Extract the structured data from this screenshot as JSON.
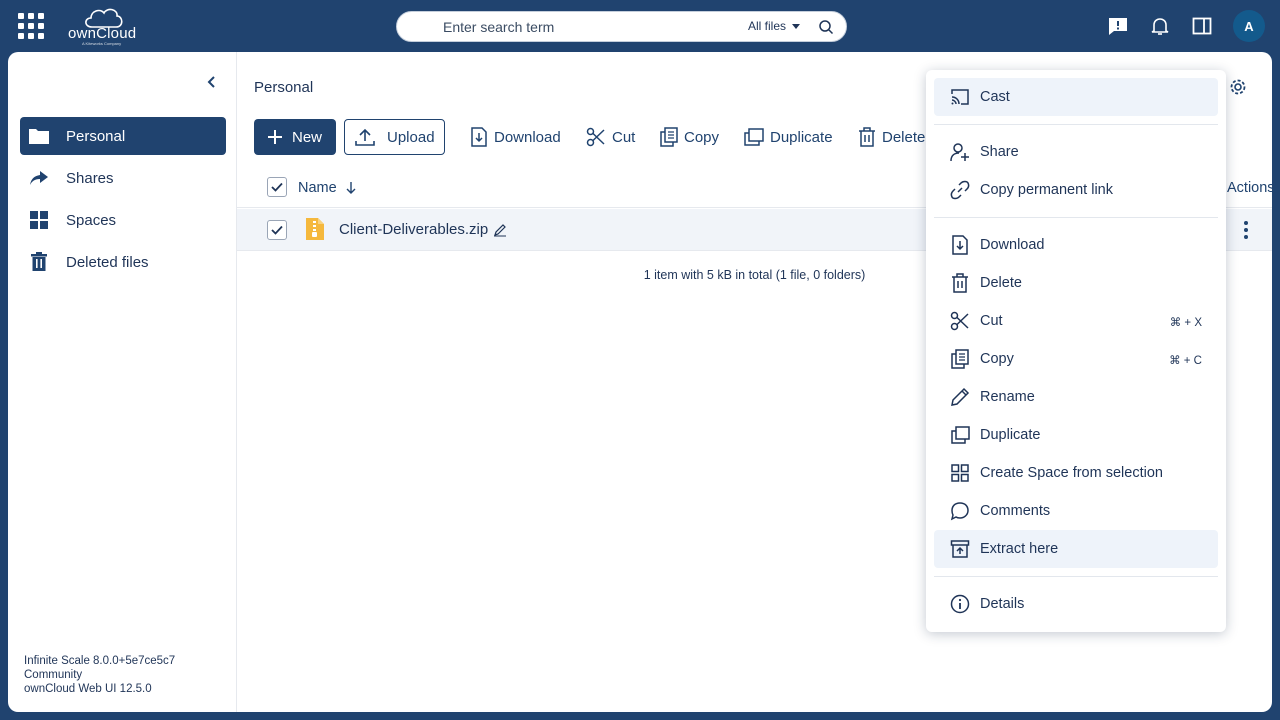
{
  "topbar": {
    "logo_text": "ownCloud",
    "logo_tagline": "A Kiteworks Company",
    "search_placeholder": "Enter search term",
    "search_scope": "All files",
    "avatar_initial": "A"
  },
  "sidebar": {
    "items": [
      {
        "label": "Personal",
        "icon": "folder-icon",
        "active": true
      },
      {
        "label": "Shares",
        "icon": "share-arrow-icon",
        "active": false
      },
      {
        "label": "Spaces",
        "icon": "grid-icon",
        "active": false
      },
      {
        "label": "Deleted files",
        "icon": "trash-icon",
        "active": false
      }
    ],
    "version_lines": [
      "Infinite Scale 8.0.0+5e7ce5c7",
      "Community",
      "ownCloud Web UI 12.5.0"
    ]
  },
  "content": {
    "breadcrumb": "Personal",
    "toolbar": {
      "new": "New",
      "upload": "Upload",
      "download": "Download",
      "cut": "Cut",
      "copy": "Copy",
      "duplicate": "Duplicate",
      "delete": "Delete"
    },
    "table": {
      "col_name": "Name",
      "col_actions": "Actions",
      "rows": [
        {
          "name": "Client-Deliverables.zip",
          "selected": true
        }
      ]
    },
    "footer": "1 item with 5 kB in total (1 file, 0 folders)"
  },
  "context_menu": {
    "groups": [
      [
        {
          "label": "Cast",
          "icon": "cast-icon",
          "highlight": true
        }
      ],
      [
        {
          "label": "Share",
          "icon": "user-plus-icon"
        },
        {
          "label": "Copy permanent link",
          "icon": "link-icon"
        }
      ],
      [
        {
          "label": "Download",
          "icon": "download-icon"
        },
        {
          "label": "Delete",
          "icon": "trash-icon"
        },
        {
          "label": "Cut",
          "icon": "scissors-icon",
          "shortcut": "⌘ + X"
        },
        {
          "label": "Copy",
          "icon": "copy-icon",
          "shortcut": "⌘ + C"
        },
        {
          "label": "Rename",
          "icon": "pencil-icon"
        },
        {
          "label": "Duplicate",
          "icon": "duplicate-icon"
        },
        {
          "label": "Create Space from selection",
          "icon": "grid-icon"
        },
        {
          "label": "Comments",
          "icon": "comment-icon"
        },
        {
          "label": "Extract here",
          "icon": "archive-icon",
          "highlight": true
        }
      ],
      [
        {
          "label": "Details",
          "icon": "info-icon"
        }
      ]
    ]
  },
  "colors": {
    "brand": "#20436f",
    "accent": "#135a8c",
    "zip_icon": "#f5b83d"
  }
}
